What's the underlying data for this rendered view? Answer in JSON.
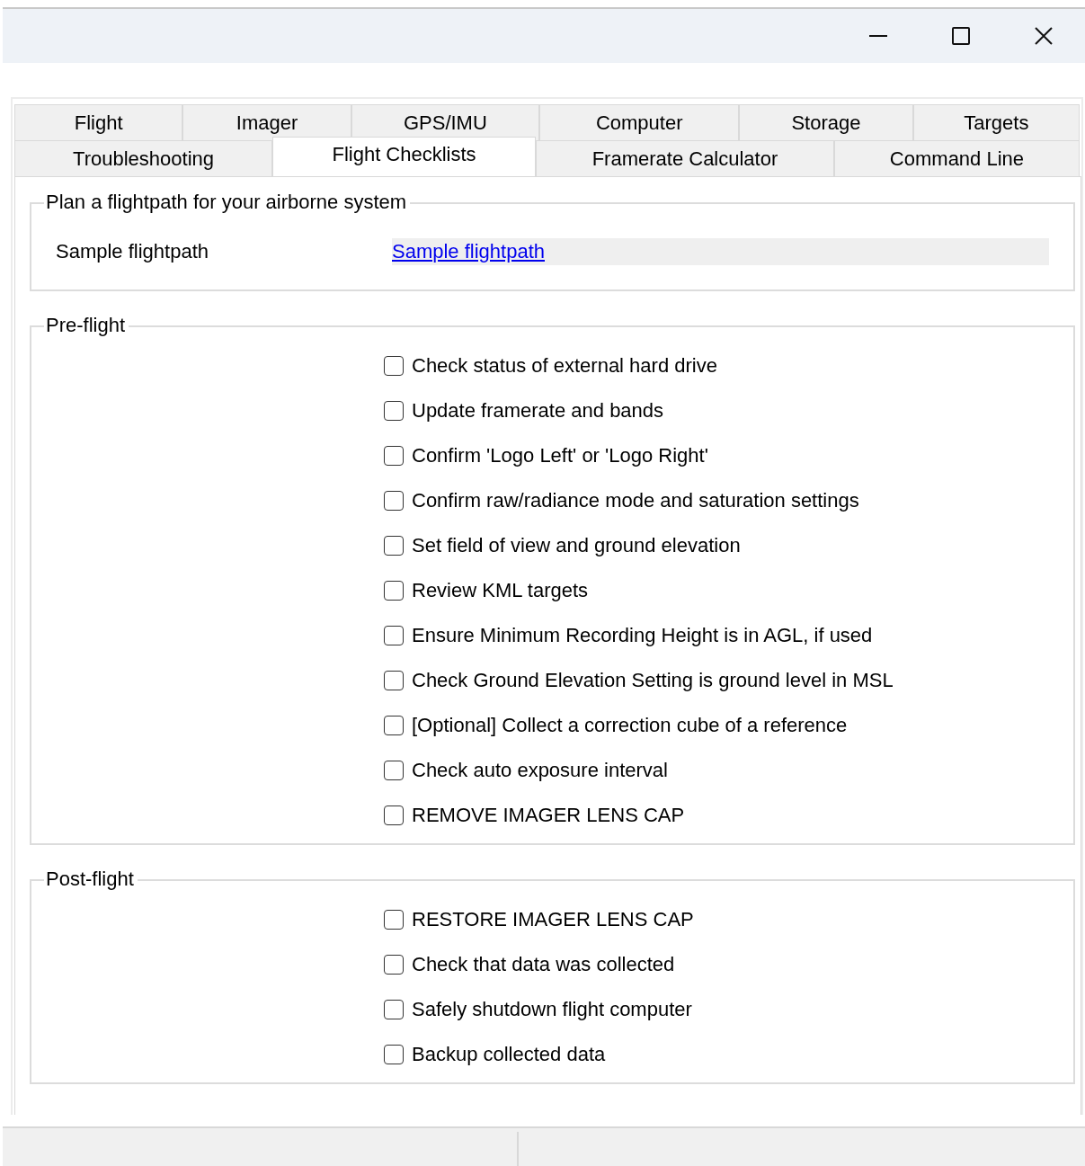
{
  "window": {
    "controls": [
      {
        "kind": "minimize"
      },
      {
        "kind": "maximize"
      },
      {
        "kind": "close"
      }
    ]
  },
  "tabs": [
    [
      {
        "label": "Flight",
        "selected": false
      },
      {
        "label": "Imager",
        "selected": false
      },
      {
        "label": "GPS/IMU",
        "selected": false
      },
      {
        "label": "Computer",
        "selected": false
      },
      {
        "label": "Storage",
        "selected": false
      },
      {
        "label": "Targets",
        "selected": false
      }
    ],
    [
      {
        "label": "Troubleshooting",
        "selected": false
      },
      {
        "label": "Flight Checklists",
        "selected": true
      },
      {
        "label": "Framerate Calculator",
        "selected": false
      },
      {
        "label": "Command Line",
        "selected": false
      }
    ]
  ],
  "flightpath_group": {
    "title": "Plan a flightpath for your airborne system",
    "label": "Sample flightpath",
    "link": "Sample flightpath"
  },
  "groups": [
    {
      "title": "Pre-flight",
      "items": [
        {
          "label": "Check status of external hard drive",
          "checked": false
        },
        {
          "label": "Update framerate and bands",
          "checked": false
        },
        {
          "label": "Confirm 'Logo Left' or 'Logo Right'",
          "checked": false
        },
        {
          "label": "Confirm raw/radiance mode and saturation settings",
          "checked": false
        },
        {
          "label": "Set field of view and ground elevation",
          "checked": false
        },
        {
          "label": "Review KML targets",
          "checked": false
        },
        {
          "label": "Ensure Minimum Recording Height is in AGL, if used",
          "checked": false
        },
        {
          "label": "Check Ground Elevation Setting is ground level in MSL",
          "checked": false
        },
        {
          "label": "[Optional] Collect a correction cube of a reference",
          "checked": false
        },
        {
          "label": "Check auto exposure interval",
          "checked": false
        },
        {
          "label": "REMOVE IMAGER LENS CAP",
          "checked": false
        }
      ]
    },
    {
      "title": "Post-flight",
      "items": [
        {
          "label": "RESTORE IMAGER LENS CAP",
          "checked": false
        },
        {
          "label": "Check that data was collected",
          "checked": false
        },
        {
          "label": "Safely shutdown flight computer",
          "checked": false
        },
        {
          "label": "Backup collected data",
          "checked": false
        }
      ]
    }
  ]
}
